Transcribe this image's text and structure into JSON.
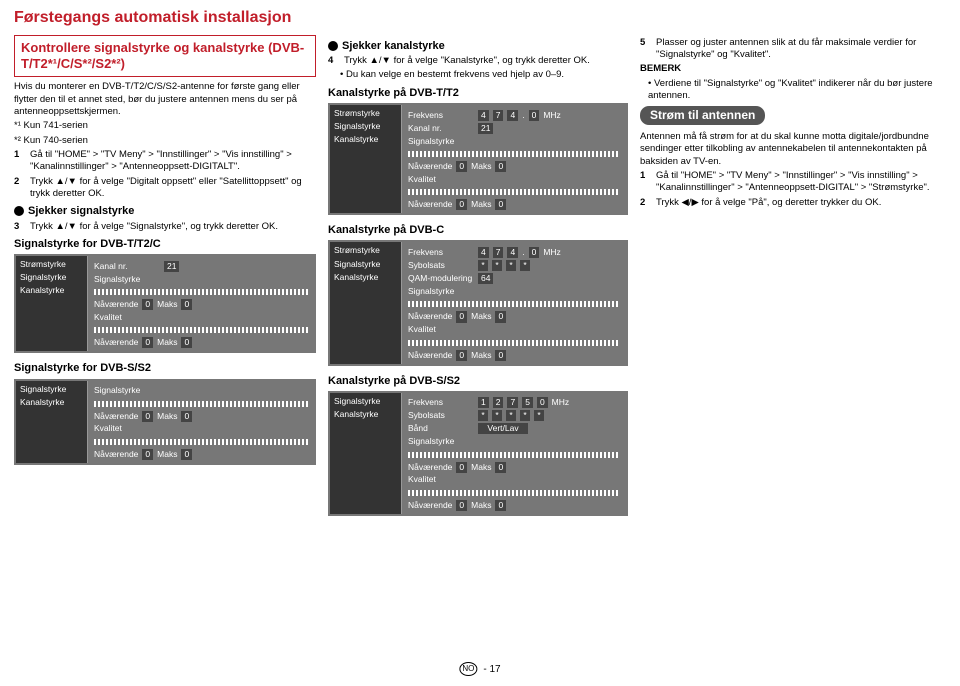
{
  "page": {
    "title": "Førstegangs automatisk installasjon",
    "footer_lang": "NO",
    "footer_page": "- 17"
  },
  "col1": {
    "box_title": "Kontrollere signalstyrke og kanalstyrke (DVB-T/T2*¹/C/S*²/S2*²)",
    "intro": "Hvis du monterer en DVB-T/T2/C/S/S2-antenne for første gang eller flytter den til et annet sted, bør du justere antennen mens du ser på antenneoppsett­skjermen.",
    "note1": "*¹ Kun 741-serien",
    "note2": "*² Kun 740-serien",
    "step1": "Gå til \"HOME\" > \"TV Meny\" > \"Innstillinger\" > \"Vis innstilling\" > \"Kanalinnstillinger\" > \"Antenneoppsett-DIGITALT\".",
    "step2": "Trykk ▲/▼ for å velge \"Digitalt oppsett\" eller \"Satellittoppsett\" og trykk deretter OK.",
    "sub1": "Sjekker signalstyrke",
    "step3": "Trykk ▲/▼ for å velge \"Signalstyrke\", og trykk deretter OK.",
    "d1_title": "Signalstyrke for DVB-T/T2/C",
    "d2_title": "Signalstyrke for DVB-S/S2"
  },
  "col2": {
    "sub1": "Sjekker kanalstyrke",
    "step4": "Trykk ▲/▼ for å velge \"Kanalstyrke\", og trykk deretter OK.",
    "step4_note": "Du kan velge en bestemt frekvens ved hjelp av 0–9.",
    "d1_title": "Kanalstyrke på DVB-T/T2",
    "d2_title": "Kanalstyrke på DVB-C",
    "d3_title": "Kanalstyrke på DVB-S/S2"
  },
  "col3": {
    "step5": "Plasser og juster antennen slik at du får maksimale verdier for \"Signalstyrke\" og \"Kvalitet\".",
    "bemerk": "BEMERK",
    "bemerk_item": "Verdiene til \"Signalstyrke\" og \"Kvalitet\" indikerer når du bør justere antennen.",
    "stripe": "Strøm til antennen",
    "p1": "Antennen må få strøm for at du skal kunne motta digitale/jordbundne sendinger etter tilkobling av antennekabelen til antennekontakten på baksiden av TV-en.",
    "s1": "Gå til \"HOME\" > \"TV Meny\" > \"Innstillinger\" > \"Vis innstilling\" > \"Kanalinnstillinger\" > \"Antenneoppsett-DIGITAL\" > \"Strømstyrke\".",
    "s2": "Trykk ◀/▶ for å velge \"På\", og deretter trykker du OK."
  },
  "labels": {
    "stromstyrke": "Strømstyrke",
    "signalstyrke": "Signalstyrke",
    "kanalstyrke": "Kanalstyrke",
    "kanalnr": "Kanal nr.",
    "frekvens": "Frekvens",
    "sybolsats": "Sybolsats",
    "qam": "QAM-modulering",
    "band": "Bånd",
    "vertlav": "Vert/Lav",
    "navaerende": "Nåværende",
    "maks": "Maks",
    "kvalitet": "Kvalitet",
    "mhz": "MHz",
    "ch21": "21",
    "qam64": "64",
    "f474": [
      "4",
      "7",
      "4",
      ".",
      "0"
    ],
    "f1275": [
      "1",
      "2",
      "7",
      "5",
      "0"
    ],
    "stars4": [
      "*",
      "*",
      "*",
      "*"
    ],
    "stars5": [
      "*",
      "*",
      "*",
      "*",
      "*"
    ],
    "zero": "0"
  }
}
